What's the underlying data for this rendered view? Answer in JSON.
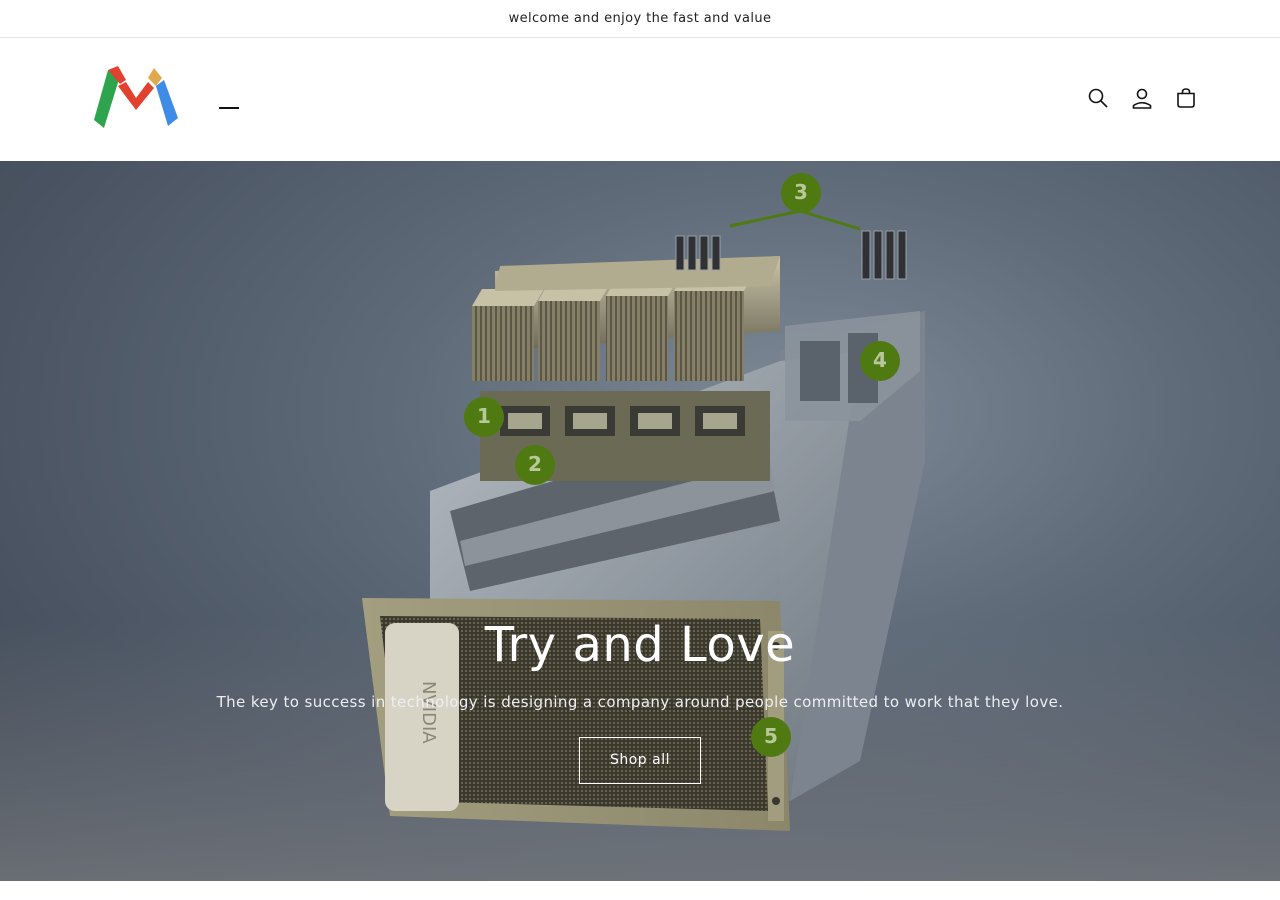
{
  "announcement": {
    "text": "welcome and enjoy the fast and value"
  },
  "header": {
    "logo_alt": "M",
    "icons": [
      "search-icon",
      "account-icon",
      "cart-icon"
    ]
  },
  "hero": {
    "heading": "Try and Love",
    "subheading": "The key to success in technology is designing a company around people committed to work that they love.",
    "button_label": "Shop all",
    "callouts": [
      "1",
      "2",
      "3",
      "4",
      "5"
    ],
    "server_brand": "NVIDIA"
  },
  "colors": {
    "accent_green": "#4f7a12",
    "logo_red": "#e2412f",
    "logo_green": "#2ea44f",
    "logo_blue": "#3f8be8",
    "logo_gold": "#e0a94b"
  }
}
